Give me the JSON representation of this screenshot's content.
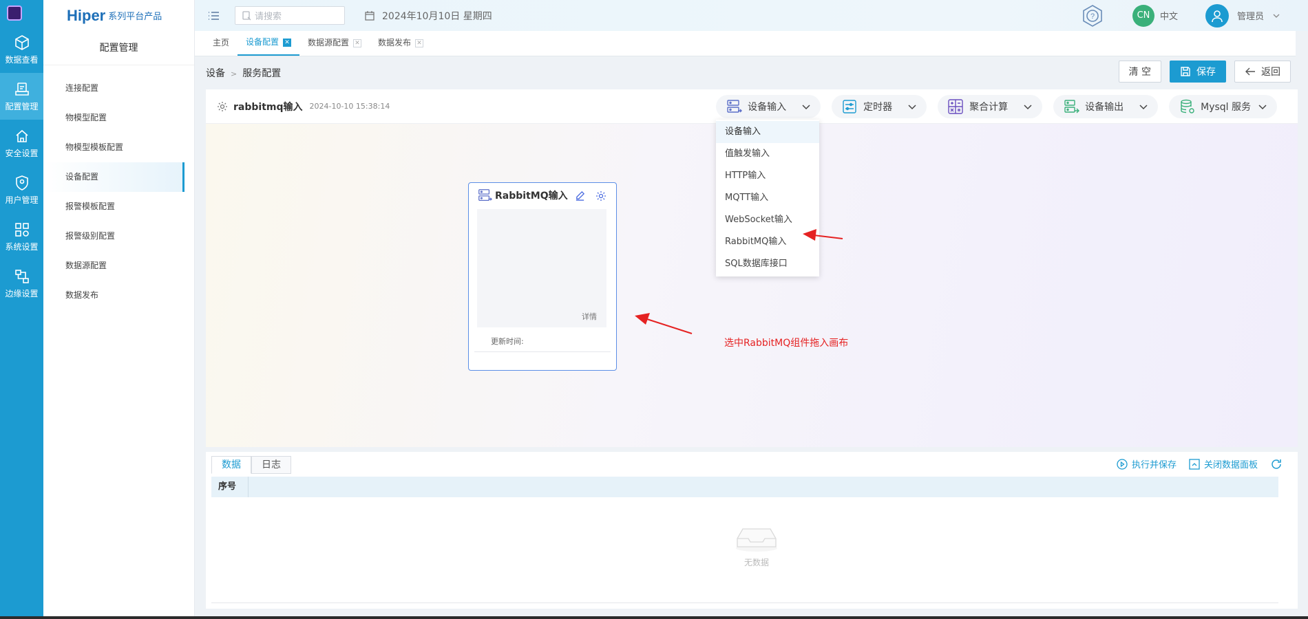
{
  "brand": {
    "name": "Hiper",
    "subtitle": "系列平台产品"
  },
  "rail": {
    "items": [
      {
        "label": "数据查看",
        "icon": "cube-icon"
      },
      {
        "label": "配置管理",
        "icon": "config-icon",
        "active": true
      },
      {
        "label": "安全设置",
        "icon": "security-icon"
      },
      {
        "label": "用户管理",
        "icon": "user-shield-icon"
      },
      {
        "label": "系统设置",
        "icon": "system-icon"
      },
      {
        "label": "边缘设置",
        "icon": "edge-icon"
      }
    ]
  },
  "sidebar": {
    "title": "配置管理",
    "items": [
      {
        "label": "连接配置"
      },
      {
        "label": "物模型配置"
      },
      {
        "label": "物模型模板配置"
      },
      {
        "label": "设备配置",
        "active": true
      },
      {
        "label": "报警模板配置"
      },
      {
        "label": "报警级别配置"
      },
      {
        "label": "数据源配置"
      },
      {
        "label": "数据发布"
      }
    ]
  },
  "header": {
    "search_placeholder": "请搜索",
    "date": "2024年10月10日 星期四",
    "lang_code": "CN",
    "lang_label": "中文",
    "user": "管理员"
  },
  "tabs": [
    {
      "label": "主页"
    },
    {
      "label": "设备配置",
      "active": true
    },
    {
      "label": "数据源配置"
    },
    {
      "label": "数据发布"
    }
  ],
  "breadcrumb": {
    "root": "设备",
    "sep": ">",
    "current": "服务配置"
  },
  "actions": {
    "clear": "清 空",
    "save": "保存",
    "back": "返回"
  },
  "panel": {
    "title": "rabbitmq输入",
    "time": "2024-10-10 15:38:14",
    "tools": [
      {
        "label": "设备输入",
        "icon": "device-input-icon"
      },
      {
        "label": "定时器",
        "icon": "timer-icon"
      },
      {
        "label": "聚合计算",
        "icon": "calc-icon"
      },
      {
        "label": "设备输出",
        "icon": "device-output-icon"
      },
      {
        "label": "Mysql 服务",
        "icon": "database-icon"
      }
    ]
  },
  "dropdown": {
    "items": [
      "设备输入",
      "值触发输入",
      "HTTP输入",
      "MQTT输入",
      "WebSocket输入",
      "RabbitMQ输入",
      "SQL数据库接口"
    ]
  },
  "node": {
    "name": "RabbitMQ输入",
    "detail": "详情",
    "updated_label": "更新时间:"
  },
  "annotation": {
    "text": "选中RabbitMQ组件拖入画布",
    "color": "#e52222"
  },
  "datapanel": {
    "tabs": [
      {
        "label": "数据",
        "active": true
      },
      {
        "label": "日志"
      }
    ],
    "run_save": "执行并保存",
    "close_panel": "关闭数据面板",
    "column": "序号",
    "empty": "无数据"
  },
  "colors": {
    "accent": "#1c9bd1",
    "rail": "#1c9bd1",
    "annotation": "#e52222"
  }
}
